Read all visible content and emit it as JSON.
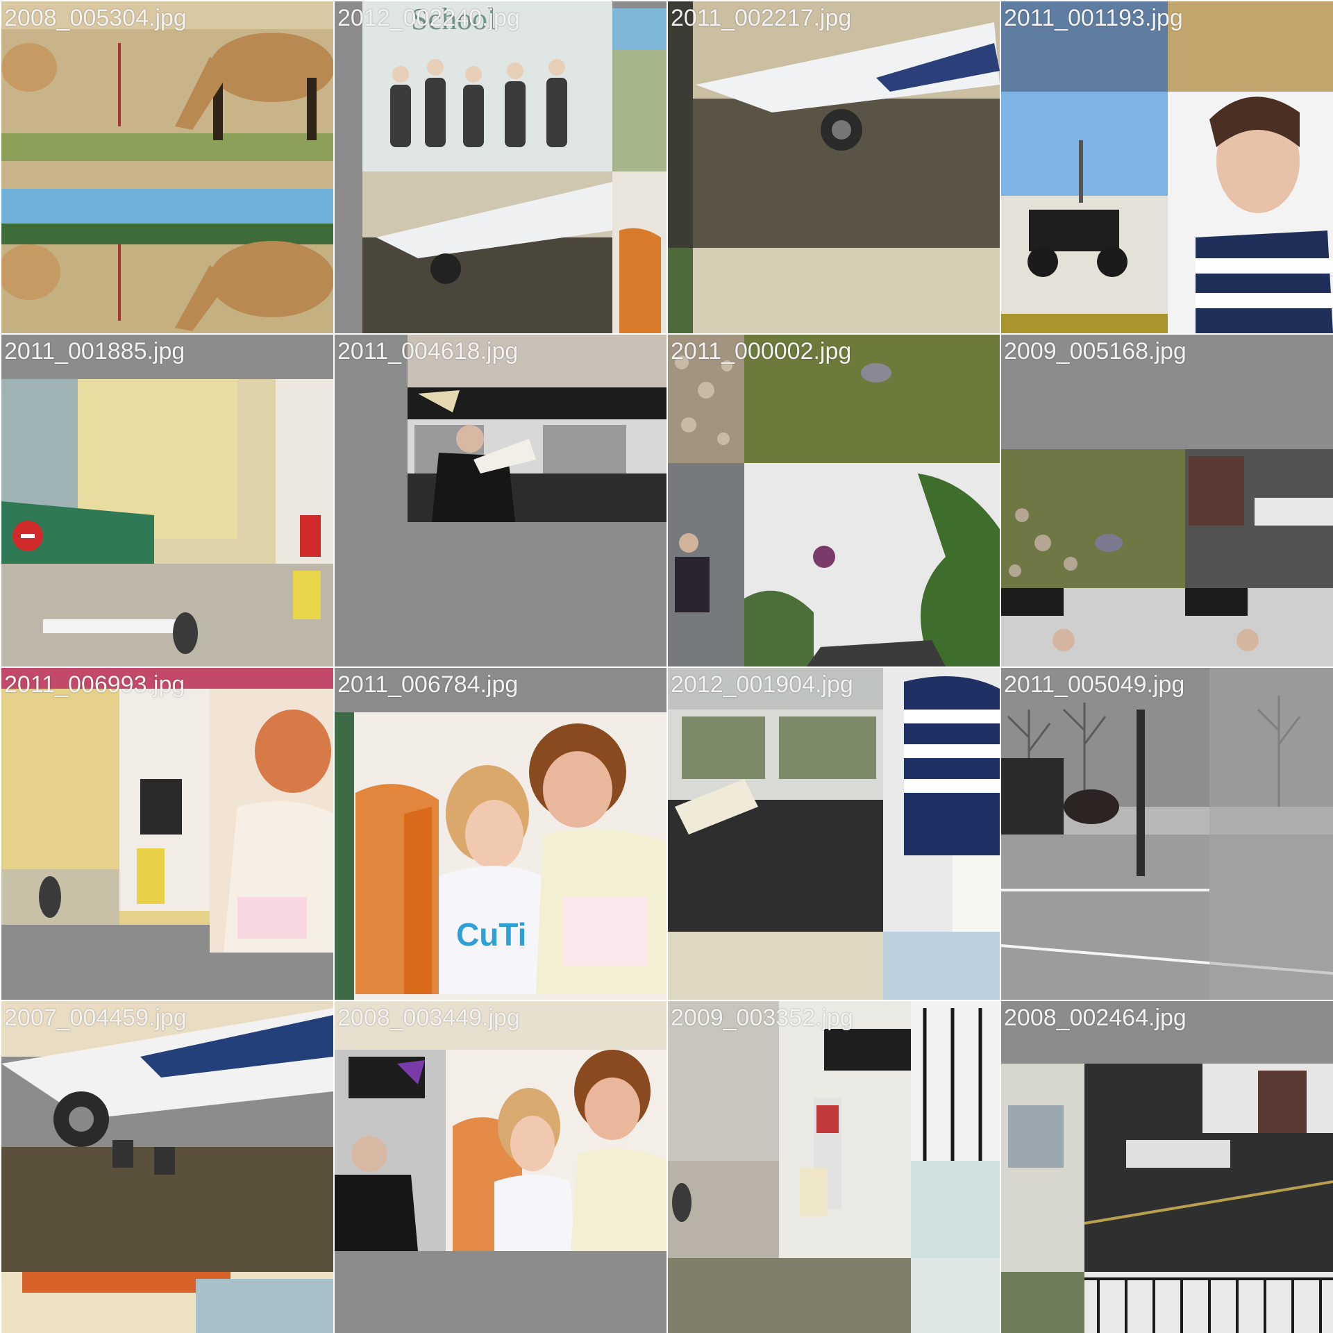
{
  "tiles": [
    {
      "filename": "2008_005304.jpg",
      "description": "horse-and-foal-grazing-collage"
    },
    {
      "filename": "2012_002240.jpg",
      "description": "jumping-group-and-airplane-collage"
    },
    {
      "filename": "2011_002217.jpg",
      "description": "airplane-on-wet-tarmac"
    },
    {
      "filename": "2011_001193.jpg",
      "description": "vintage-car-and-surprised-woman-collage"
    },
    {
      "filename": "2011_001885.jpg",
      "description": "street-scene-with-shophouses"
    },
    {
      "filename": "2011_004618.jpg",
      "description": "man-reading-on-train"
    },
    {
      "filename": "2011_000002.jpg",
      "description": "pigeon-and-jumping-people-collage"
    },
    {
      "filename": "2009_005168.jpg",
      "description": "pigeon-bus-and-train-collage"
    },
    {
      "filename": "2011_006993.jpg",
      "description": "street-scene-and-woman-reading-collage"
    },
    {
      "filename": "2011_006784.jpg",
      "description": "child-and-woman-reading-card"
    },
    {
      "filename": "2012_001904.jpg",
      "description": "train-passenger-and-coffee-collage"
    },
    {
      "filename": "2011_005049.jpg",
      "description": "horse-carriage-in-park"
    },
    {
      "filename": "2007_004459.jpg",
      "description": "airplane-and-buildings-collage"
    },
    {
      "filename": "2008_003449.jpg",
      "description": "train-passenger-and-child-collage"
    },
    {
      "filename": "2009_003352.jpg",
      "description": "street-storefront-collage"
    },
    {
      "filename": "2008_002464.jpg",
      "description": "bus-terminal-and-fence-collage"
    }
  ],
  "colors": {
    "background_gray": "#8c8c8c",
    "label_text": "#f2f2f2"
  }
}
